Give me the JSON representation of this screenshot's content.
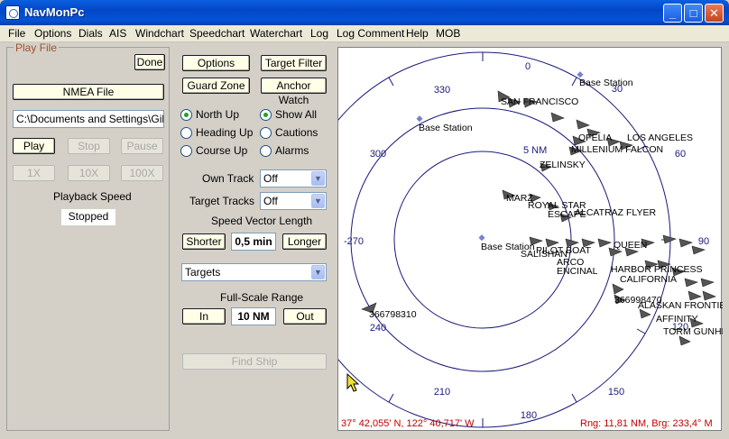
{
  "window": {
    "title": "NavMonPc"
  },
  "menu": [
    "File",
    "Options",
    "Dials",
    "AIS",
    "Windchart",
    "Speedchart",
    "Waterchart",
    "Log",
    "Log Comment",
    "Help",
    "MOB"
  ],
  "play_file": {
    "group_title": "Play File",
    "done": "Done",
    "nmea_file": "NMEA File",
    "path": "C:\\Documents and Settings\\Gillet",
    "play": "Play",
    "stop": "Stop",
    "pause": "Pause",
    "speed_1x": "1X",
    "speed_10x": "10X",
    "speed_100x": "100X",
    "playback_speed_label": "Playback Speed",
    "playback_status": "Stopped"
  },
  "controls": {
    "options": "Options",
    "target_filter": "Target Filter",
    "guard_zone": "Guard Zone",
    "anchor_watch": "Anchor Watch",
    "north_up": "North Up",
    "heading_up": "Heading Up",
    "course_up": "Course Up",
    "show_all": "Show All",
    "cautions": "Cautions",
    "alarms": "Alarms",
    "own_track_label": "Own Track",
    "own_track_value": "Off",
    "target_tracks_label": "Target Tracks",
    "target_tracks_value": "Off",
    "speed_vector_label": "Speed Vector Length",
    "shorter": "Shorter",
    "speed_vector_value": "0,5 min",
    "longer": "Longer",
    "targets_select": "Targets",
    "full_scale_label": "Full-Scale Range",
    "zoom_in": "In",
    "range_value": "10 NM",
    "zoom_out": "Out",
    "find_ship": "Find Ship"
  },
  "radar": {
    "bearings": [
      "0",
      "30",
      "60",
      "90",
      "120",
      "150",
      "180",
      "210",
      "240",
      "-270",
      "300",
      "330"
    ],
    "ring_label": "5 NM",
    "position": "37° 42,055' N, 122° 40,717' W",
    "range_bearing": "Rng: 11,81 NM, Brg: 233,4° M",
    "targets": [
      "Base Station",
      "Base Station",
      "Base Station",
      "SAN FRANCISCO",
      "OFELIA",
      "LOS ANGELES",
      "MILLENIUM FALCON",
      "ZELINSKY",
      "MARZ",
      "ROYAL STAR",
      "ESCAPE",
      "ALCATRAZ FLYER",
      "PILOT BOAT",
      "QUEEN",
      "SALISHAN",
      "ARCO",
      "ENCINAL",
      "HARBOR PRINCESS",
      "CALIFORNIA",
      "366798310",
      "366998470",
      "ALASKAN FRONTIER",
      "AFFINITY",
      "TORM GUNHILD"
    ]
  }
}
